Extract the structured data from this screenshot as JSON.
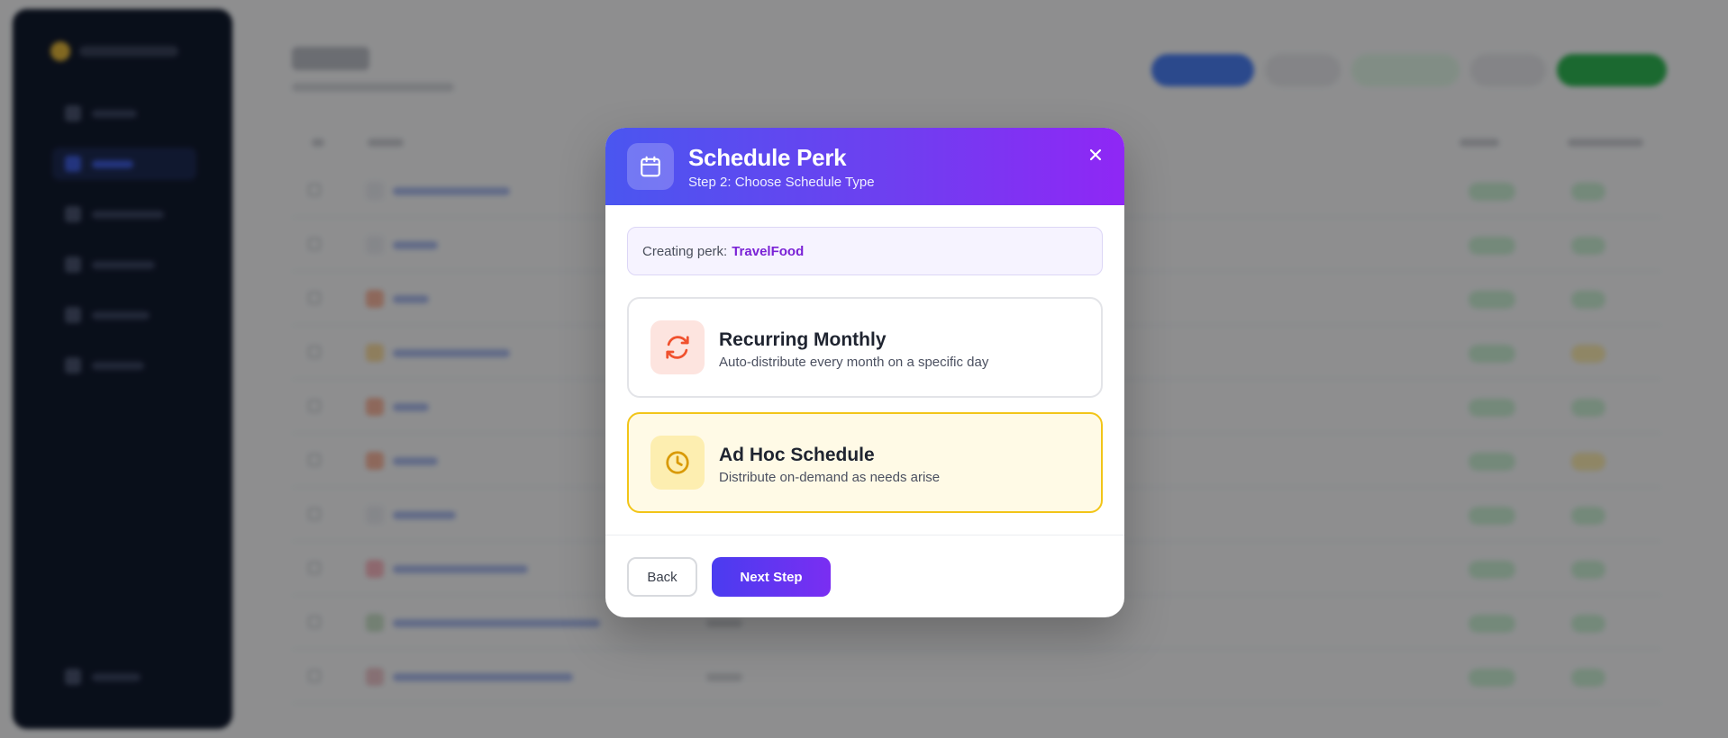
{
  "modal": {
    "title": "Schedule Perk",
    "subtitle": "Step 2: Choose Schedule Type",
    "header_icon": "calendar-icon",
    "close_icon": "close-icon"
  },
  "perk_banner": {
    "label": "Creating perk:",
    "perk_name": "TravelFood"
  },
  "options": [
    {
      "id": "recurring",
      "icon": "refresh-icon",
      "title": "Recurring Monthly",
      "description": "Auto-distribute every month on a specific day",
      "selected": false
    },
    {
      "id": "adhoc",
      "icon": "clock-icon",
      "title": "Ad Hoc Schedule",
      "description": "Distribute on-demand as needs arise",
      "selected": true
    }
  ],
  "footer": {
    "back_label": "Back",
    "next_label": "Next Step"
  },
  "colors": {
    "header_gradient_start": "#4a56f0",
    "header_gradient_end": "#8f27f5",
    "perk_name": "#7a22d6",
    "recurring_icon": "#f0512e",
    "adhoc_icon": "#d99a06",
    "adhoc_border": "#f2c518",
    "next_button": "#4a3cf0"
  }
}
